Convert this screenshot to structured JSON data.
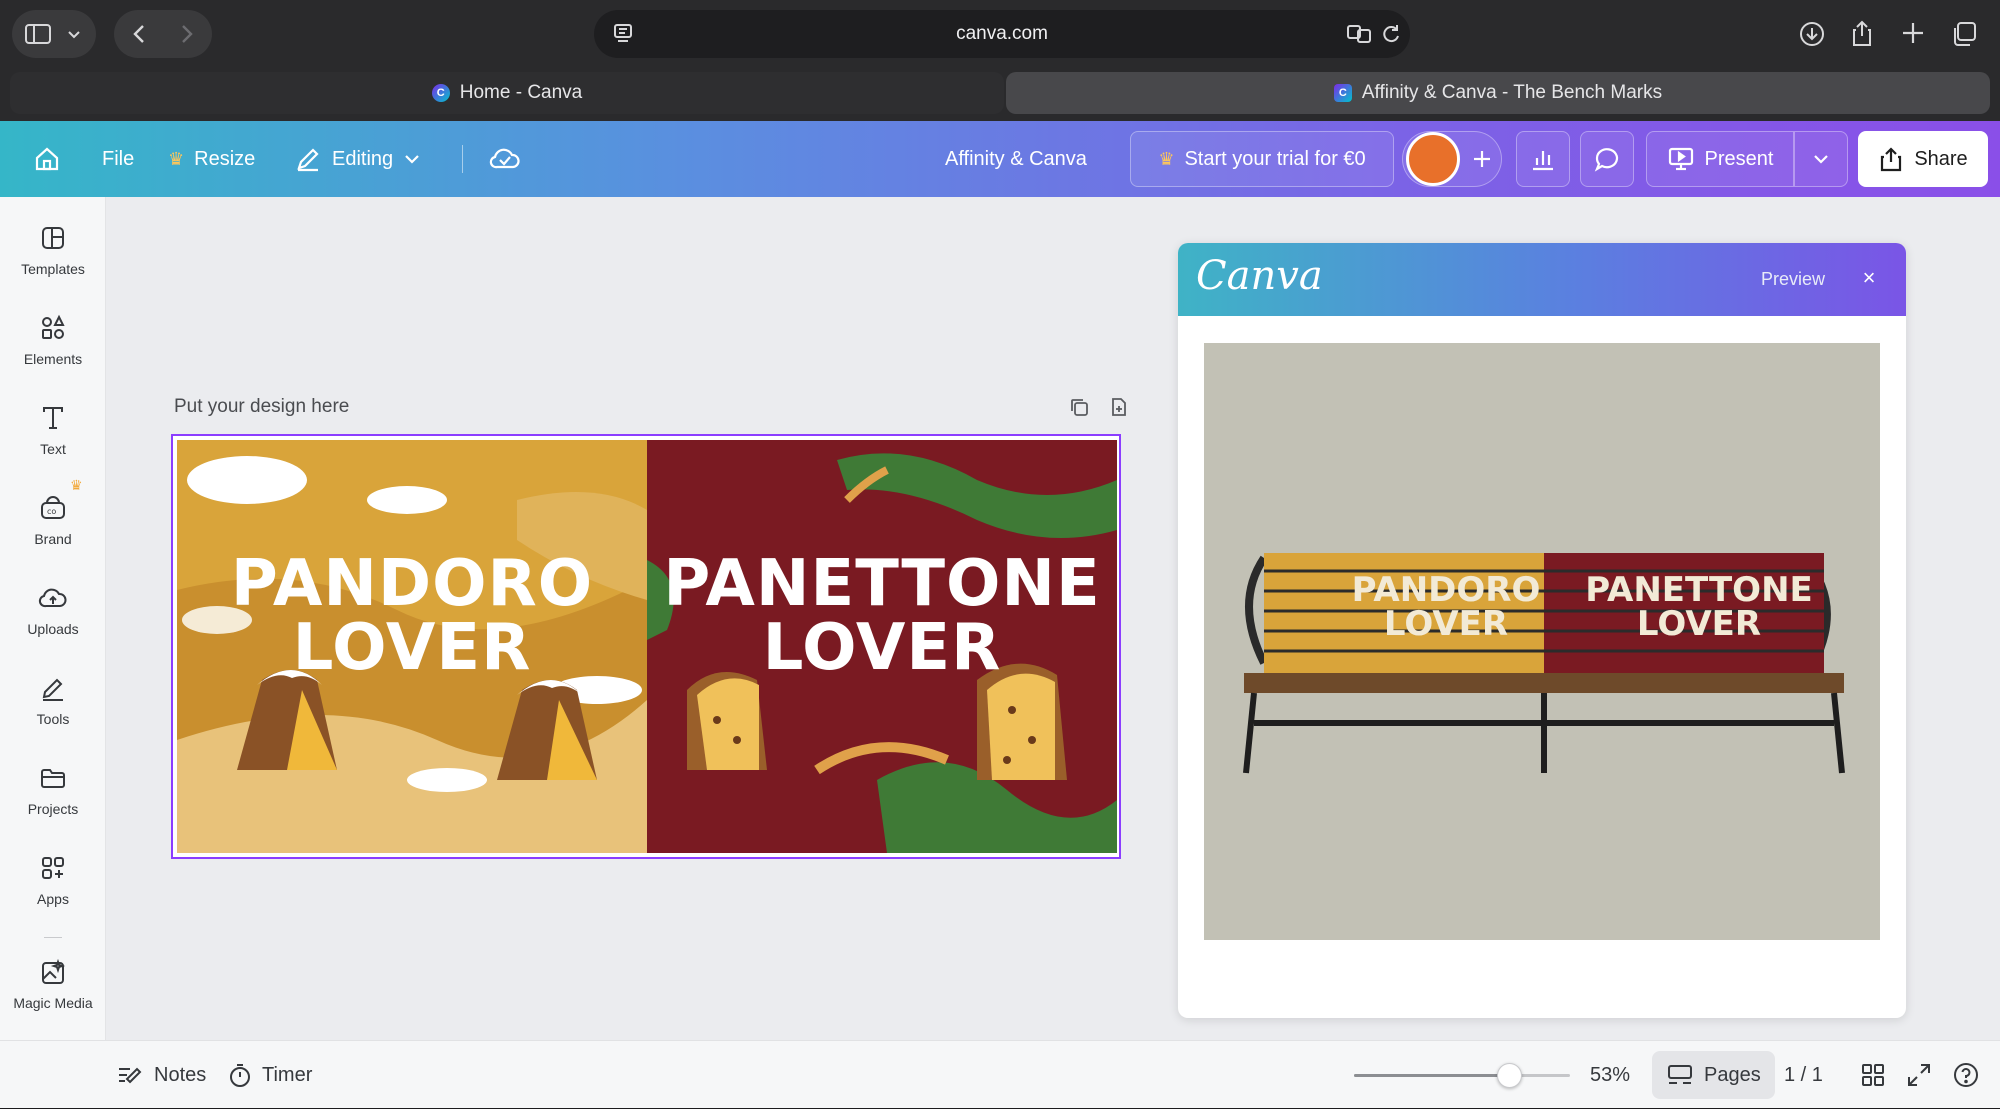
{
  "browser": {
    "url": "canva.com",
    "tabs": [
      {
        "label": "Home - Canva",
        "active": false
      },
      {
        "label": "Affinity & Canva - The Bench Marks",
        "active": true
      }
    ]
  },
  "header": {
    "file": "File",
    "resize": "Resize",
    "editing": "Editing",
    "doc_title": "Affinity & Canva",
    "trial": "Start your trial for €0",
    "present": "Present",
    "share": "Share",
    "accent": "#8b3dff",
    "avatar_color": "#e8702a"
  },
  "sidebar": {
    "items": [
      {
        "label": "Templates",
        "icon": "templates-icon"
      },
      {
        "label": "Elements",
        "icon": "elements-icon"
      },
      {
        "label": "Text",
        "icon": "text-icon"
      },
      {
        "label": "Brand",
        "icon": "brand-icon"
      },
      {
        "label": "Uploads",
        "icon": "uploads-icon"
      },
      {
        "label": "Tools",
        "icon": "tools-icon"
      },
      {
        "label": "Projects",
        "icon": "projects-icon"
      },
      {
        "label": "Apps",
        "icon": "apps-icon"
      },
      {
        "label": "Magic Media",
        "icon": "magic-media-icon"
      }
    ]
  },
  "canvas": {
    "design_label": "Put your design here",
    "left_text": [
      "PANDORO",
      "LOVER"
    ],
    "right_text": [
      "PANETTONE",
      "LOVER"
    ],
    "left_color": "#d9a43a",
    "right_color": "#7a1a22"
  },
  "preview": {
    "logo": "Canva",
    "title": "Preview",
    "close": "×",
    "bench_left": [
      "PANDORO",
      "LOVER"
    ],
    "bench_right": [
      "PANETTONE",
      "LOVER"
    ]
  },
  "bottom": {
    "notes": "Notes",
    "timer": "Timer",
    "zoom_percent": "53%",
    "zoom_value": 0.53,
    "pages": "Pages",
    "page_count": "1 / 1"
  }
}
